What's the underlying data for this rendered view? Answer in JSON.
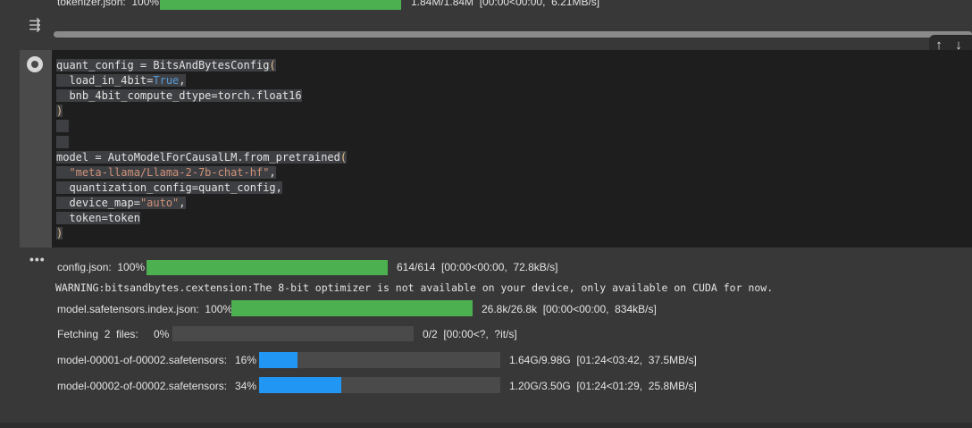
{
  "previous_output": {
    "label": "tokenizer.json:  100%",
    "stats": "1.84M/1.84M  [00:00<00:00,  6.21MB/s]",
    "progress": 1.0
  },
  "icons": {
    "collapse": "collapse-output-icon",
    "run": "run-cell-icon",
    "move_up": "arrow-up-icon",
    "move_down": "arrow-down-icon",
    "output_menu": "more-horizontal-icon"
  },
  "toolbar": {
    "move_up": "↑",
    "move_down": "↓"
  },
  "gutter": {
    "collapse_glyph": "⇶",
    "output_dots": "•••"
  },
  "code_lines": [
    [
      {
        "t": "quant_config = BitsAndBytesConfig",
        "c": "plain"
      },
      {
        "t": "(",
        "c": "paren"
      }
    ],
    [
      {
        "t": "  ",
        "c": "ind"
      },
      {
        "t": "load_in_4bit=",
        "c": "plain"
      },
      {
        "t": "True",
        "c": "kw"
      },
      {
        "t": ",",
        "c": "plain"
      }
    ],
    [
      {
        "t": "  ",
        "c": "ind"
      },
      {
        "t": "bnb_4bit_compute_dtype=torch.float16",
        "c": "plain"
      }
    ],
    [
      {
        "t": ")",
        "c": "paren"
      }
    ],
    [
      {
        "t": "",
        "c": "plain"
      }
    ],
    [
      {
        "t": "",
        "c": "plain"
      }
    ],
    [
      {
        "t": "model = AutoModelForCausalLM.from_pretrained",
        "c": "plain"
      },
      {
        "t": "(",
        "c": "paren"
      }
    ],
    [
      {
        "t": "  ",
        "c": "ind"
      },
      {
        "t": "\"meta-llama/Llama-2-7b-chat-hf\"",
        "c": "str"
      },
      {
        "t": ",",
        "c": "plain"
      }
    ],
    [
      {
        "t": "  ",
        "c": "ind"
      },
      {
        "t": "quantization_config=quant_config,",
        "c": "plain"
      }
    ],
    [
      {
        "t": "  ",
        "c": "ind"
      },
      {
        "t": "device_map=",
        "c": "plain"
      },
      {
        "t": "\"auto\"",
        "c": "str"
      },
      {
        "t": ",",
        "c": "plain"
      }
    ],
    [
      {
        "t": "  ",
        "c": "ind"
      },
      {
        "t": "token=token",
        "c": "plain"
      }
    ],
    [
      {
        "t": ")",
        "c": "paren"
      }
    ]
  ],
  "outputs": {
    "config": {
      "label": "config.json:  100%",
      "stats": "614/614  [00:00<00:00,  72.8kB/s]",
      "progress": 1.0
    },
    "warning": "WARNING:bitsandbytes.cextension:The 8-bit optimizer is not available on your device, only available on CUDA for now.",
    "index": {
      "label": "model.safetensors.index.json:  100%",
      "stats": "26.8k/26.8k  [00:00<00:00,  834kB/s]",
      "progress": 1.0
    },
    "fetching": {
      "label": "Fetching  2  files:",
      "percent": "0%",
      "stats": "0/2  [00:00<?,  ?it/s]",
      "progress": 0.0
    },
    "shard1": {
      "label": "model-00001-of-00002.safetensors:",
      "percent": "16%",
      "stats": "1.64G/9.98G  [01:24<03:42,  37.5MB/s]",
      "progress": 0.16
    },
    "shard2": {
      "label": "model-00002-of-00002.safetensors:",
      "percent": "34%",
      "stats": "1.20G/3.50G  [01:24<01:29,  25.8MB/s]",
      "progress": 0.34
    }
  },
  "colors": {
    "complete": "#4caf50",
    "in_progress": "#2196f3",
    "track": "#4a4a4a"
  }
}
